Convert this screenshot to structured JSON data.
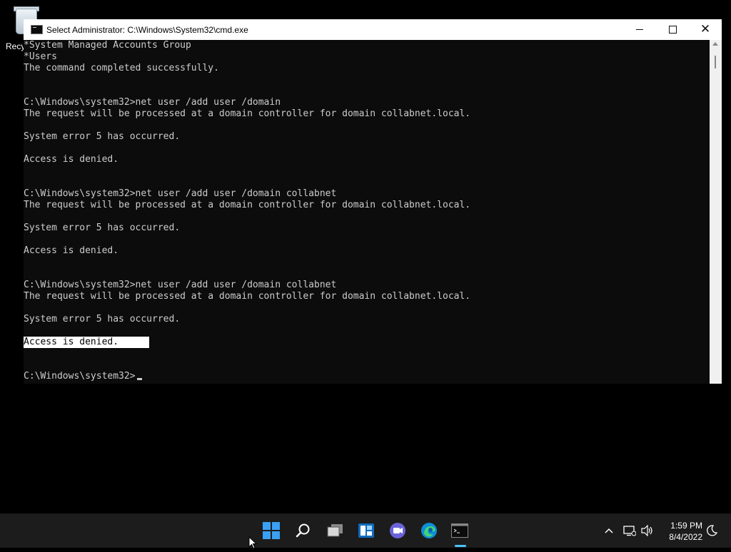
{
  "desktop": {
    "recycle_bin_label": "Recy"
  },
  "window": {
    "title": "Select Administrator: C:\\Windows\\System32\\cmd.exe",
    "minimize_icon": "minimize-icon",
    "maximize_icon": "maximize-icon",
    "close_icon": "close-icon"
  },
  "console": {
    "lines": [
      "*System Managed Accounts Group",
      "*Users",
      "The command completed successfully.",
      "",
      "",
      "C:\\Windows\\system32>net user /add user /domain",
      "The request will be processed at a domain controller for domain collabnet.local.",
      "",
      "System error 5 has occurred.",
      "",
      "Access is denied.",
      "",
      "",
      "C:\\Windows\\system32>net user /add user /domain collabnet",
      "The request will be processed at a domain controller for domain collabnet.local.",
      "",
      "System error 5 has occurred.",
      "",
      "Access is denied.",
      "",
      "",
      "C:\\Windows\\system32>net user /add user /domain collabnet",
      "The request will be processed at a domain controller for domain collabnet.local.",
      "",
      "System error 5 has occurred.",
      "",
      "Access is denied.",
      "",
      "",
      "C:\\Windows\\system32>"
    ],
    "selected_line_index": 26
  },
  "taskbar": {
    "icons": [
      "start-icon",
      "search-icon",
      "task-view-icon",
      "widgets-icon",
      "chat-icon",
      "edge-icon",
      "terminal-icon"
    ],
    "tray": {
      "chevron_icon": "chevron-up-icon",
      "network_icon": "network-icon",
      "volume_icon": "volume-icon",
      "time": "1:59 PM",
      "date": "8/4/2022",
      "focus_icon": "focus-assist-icon"
    }
  },
  "colors": {
    "console_bg": "#0c0c0c",
    "console_fg": "#cccccc",
    "taskbar_bg": "#1c1c1c",
    "accent": "#4cc2ff"
  }
}
